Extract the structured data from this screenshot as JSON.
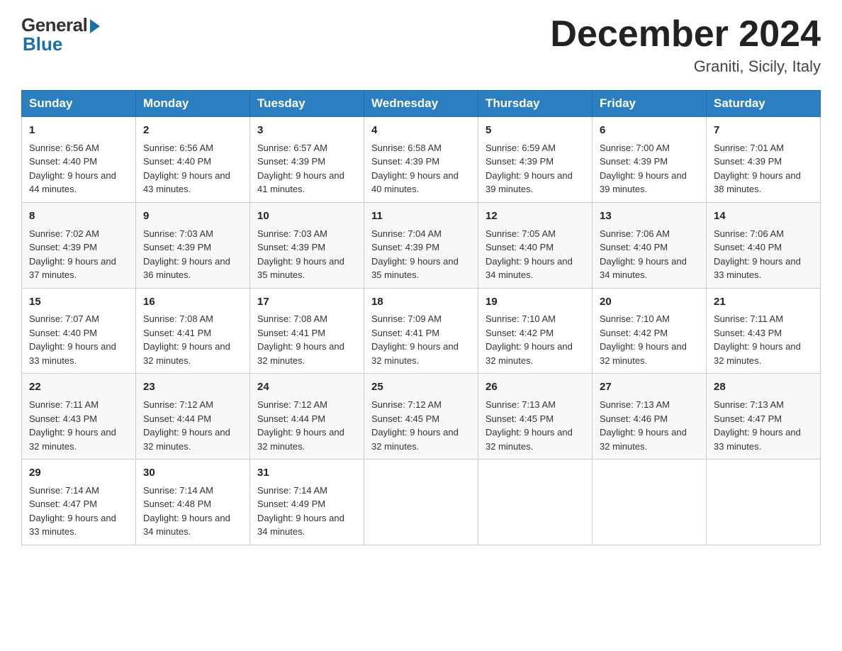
{
  "header": {
    "logo_general": "General",
    "logo_blue": "Blue",
    "month_title": "December 2024",
    "location": "Graniti, Sicily, Italy"
  },
  "weekdays": [
    "Sunday",
    "Monday",
    "Tuesday",
    "Wednesday",
    "Thursday",
    "Friday",
    "Saturday"
  ],
  "weeks": [
    [
      {
        "day": "1",
        "sunrise": "6:56 AM",
        "sunset": "4:40 PM",
        "daylight": "9 hours and 44 minutes."
      },
      {
        "day": "2",
        "sunrise": "6:56 AM",
        "sunset": "4:40 PM",
        "daylight": "9 hours and 43 minutes."
      },
      {
        "day": "3",
        "sunrise": "6:57 AM",
        "sunset": "4:39 PM",
        "daylight": "9 hours and 41 minutes."
      },
      {
        "day": "4",
        "sunrise": "6:58 AM",
        "sunset": "4:39 PM",
        "daylight": "9 hours and 40 minutes."
      },
      {
        "day": "5",
        "sunrise": "6:59 AM",
        "sunset": "4:39 PM",
        "daylight": "9 hours and 39 minutes."
      },
      {
        "day": "6",
        "sunrise": "7:00 AM",
        "sunset": "4:39 PM",
        "daylight": "9 hours and 39 minutes."
      },
      {
        "day": "7",
        "sunrise": "7:01 AM",
        "sunset": "4:39 PM",
        "daylight": "9 hours and 38 minutes."
      }
    ],
    [
      {
        "day": "8",
        "sunrise": "7:02 AM",
        "sunset": "4:39 PM",
        "daylight": "9 hours and 37 minutes."
      },
      {
        "day": "9",
        "sunrise": "7:03 AM",
        "sunset": "4:39 PM",
        "daylight": "9 hours and 36 minutes."
      },
      {
        "day": "10",
        "sunrise": "7:03 AM",
        "sunset": "4:39 PM",
        "daylight": "9 hours and 35 minutes."
      },
      {
        "day": "11",
        "sunrise": "7:04 AM",
        "sunset": "4:39 PM",
        "daylight": "9 hours and 35 minutes."
      },
      {
        "day": "12",
        "sunrise": "7:05 AM",
        "sunset": "4:40 PM",
        "daylight": "9 hours and 34 minutes."
      },
      {
        "day": "13",
        "sunrise": "7:06 AM",
        "sunset": "4:40 PM",
        "daylight": "9 hours and 34 minutes."
      },
      {
        "day": "14",
        "sunrise": "7:06 AM",
        "sunset": "4:40 PM",
        "daylight": "9 hours and 33 minutes."
      }
    ],
    [
      {
        "day": "15",
        "sunrise": "7:07 AM",
        "sunset": "4:40 PM",
        "daylight": "9 hours and 33 minutes."
      },
      {
        "day": "16",
        "sunrise": "7:08 AM",
        "sunset": "4:41 PM",
        "daylight": "9 hours and 32 minutes."
      },
      {
        "day": "17",
        "sunrise": "7:08 AM",
        "sunset": "4:41 PM",
        "daylight": "9 hours and 32 minutes."
      },
      {
        "day": "18",
        "sunrise": "7:09 AM",
        "sunset": "4:41 PM",
        "daylight": "9 hours and 32 minutes."
      },
      {
        "day": "19",
        "sunrise": "7:10 AM",
        "sunset": "4:42 PM",
        "daylight": "9 hours and 32 minutes."
      },
      {
        "day": "20",
        "sunrise": "7:10 AM",
        "sunset": "4:42 PM",
        "daylight": "9 hours and 32 minutes."
      },
      {
        "day": "21",
        "sunrise": "7:11 AM",
        "sunset": "4:43 PM",
        "daylight": "9 hours and 32 minutes."
      }
    ],
    [
      {
        "day": "22",
        "sunrise": "7:11 AM",
        "sunset": "4:43 PM",
        "daylight": "9 hours and 32 minutes."
      },
      {
        "day": "23",
        "sunrise": "7:12 AM",
        "sunset": "4:44 PM",
        "daylight": "9 hours and 32 minutes."
      },
      {
        "day": "24",
        "sunrise": "7:12 AM",
        "sunset": "4:44 PM",
        "daylight": "9 hours and 32 minutes."
      },
      {
        "day": "25",
        "sunrise": "7:12 AM",
        "sunset": "4:45 PM",
        "daylight": "9 hours and 32 minutes."
      },
      {
        "day": "26",
        "sunrise": "7:13 AM",
        "sunset": "4:45 PM",
        "daylight": "9 hours and 32 minutes."
      },
      {
        "day": "27",
        "sunrise": "7:13 AM",
        "sunset": "4:46 PM",
        "daylight": "9 hours and 32 minutes."
      },
      {
        "day": "28",
        "sunrise": "7:13 AM",
        "sunset": "4:47 PM",
        "daylight": "9 hours and 33 minutes."
      }
    ],
    [
      {
        "day": "29",
        "sunrise": "7:14 AM",
        "sunset": "4:47 PM",
        "daylight": "9 hours and 33 minutes."
      },
      {
        "day": "30",
        "sunrise": "7:14 AM",
        "sunset": "4:48 PM",
        "daylight": "9 hours and 34 minutes."
      },
      {
        "day": "31",
        "sunrise": "7:14 AM",
        "sunset": "4:49 PM",
        "daylight": "9 hours and 34 minutes."
      },
      null,
      null,
      null,
      null
    ]
  ]
}
